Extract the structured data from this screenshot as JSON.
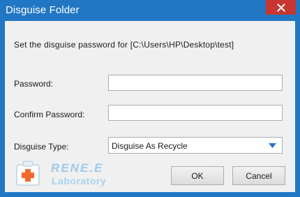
{
  "window": {
    "title": "Disguise Folder",
    "title_bar_color": "#2277c4",
    "close_button_color": "#c7372f",
    "close_icon": "close-icon"
  },
  "dialog": {
    "heading": "Set the disguise password for [C:\\Users\\HP\\Desktop\\test]",
    "password_label": "Password:",
    "password_value": "",
    "confirm_label": "Confirm Password:",
    "confirm_value": "",
    "type_label": "Disguise Type:",
    "type_selected": "Disguise As Recycle",
    "type_arrow_icon": "chevron-down-icon"
  },
  "buttons": {
    "ok": "OK",
    "cancel": "Cancel"
  },
  "logo": {
    "name": "RENE.E",
    "sub": "Laboratory",
    "icon": "first-aid-kit-icon"
  }
}
